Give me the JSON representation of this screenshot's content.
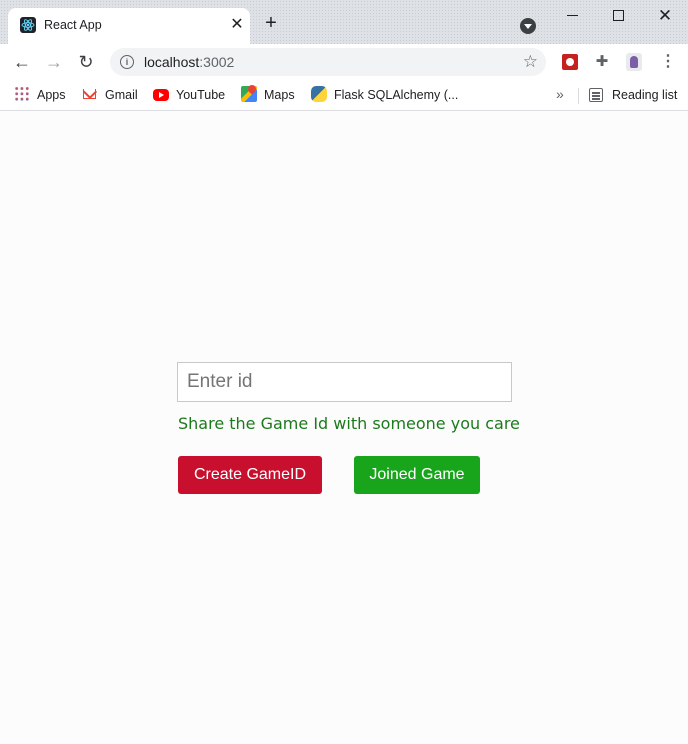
{
  "browser": {
    "tab": {
      "title": "React App",
      "close": "✕"
    },
    "new_tab": "+",
    "window": {
      "close": "✕"
    },
    "nav": {
      "back": "←",
      "forward": "→",
      "reload": "↻"
    },
    "address": {
      "host": "localhost",
      "port": ":3002"
    },
    "menu": "⋮",
    "bookmarks": [
      {
        "label": "Apps",
        "icon": "apps-grid-icon"
      },
      {
        "label": "Gmail",
        "icon": "gmail-icon"
      },
      {
        "label": "YouTube",
        "icon": "youtube-icon"
      },
      {
        "label": "Maps",
        "icon": "maps-icon"
      },
      {
        "label": "Flask SQLAlchemy (...",
        "icon": "python-icon"
      }
    ],
    "bookmarks_more": "»",
    "reading_list": "Reading list"
  },
  "page": {
    "id_input": {
      "placeholder": "Enter id",
      "value": ""
    },
    "share_text": "Share the Game Id with someone you care",
    "create_button": "Create GameID",
    "join_button": "Joined Game"
  },
  "colors": {
    "create_button": "#c8102e",
    "join_button": "#18a51c",
    "share_text": "#1c7a1c"
  }
}
